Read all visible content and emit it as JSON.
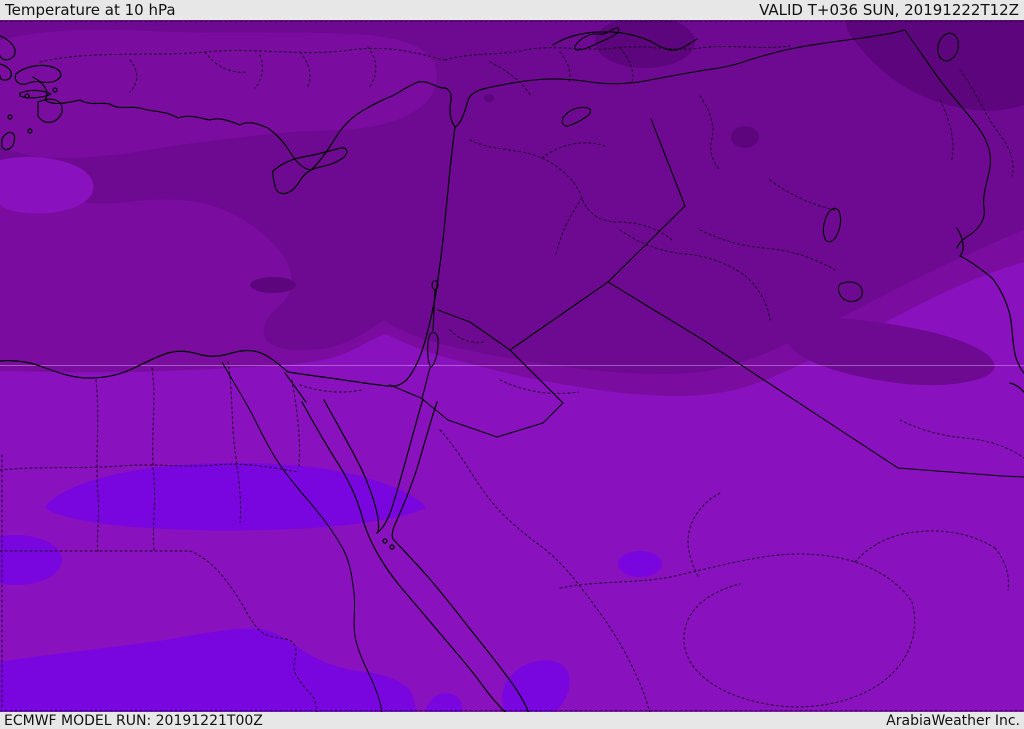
{
  "header": {
    "title": "Temperature at 10 hPa",
    "valid": "VALID T+036 SUN, 20191222T12Z"
  },
  "footer": {
    "model_run": "ECMWF MODEL RUN: 20191221T00Z",
    "credit": "ArabiaWeather Inc."
  },
  "map": {
    "parameter": "Temperature",
    "level": "10 hPa",
    "forecast_step": "T+036",
    "valid_time": "SUN, 20191222T12Z",
    "model": "ECMWF",
    "model_run_time": "20191221T00Z",
    "provider": "ArabiaWeather Inc.",
    "colors": {
      "band_mid": "#8A11BE",
      "band_cool1": "#7A0DA0",
      "band_cool2": "#6E0A92",
      "band_cool3": "#5C057C",
      "band_violet": "#7A06DF",
      "coastline": "#000000",
      "graticule": "#FFFFFF",
      "bar_bg": "#E7E7E7",
      "bar_text": "#111111"
    }
  }
}
